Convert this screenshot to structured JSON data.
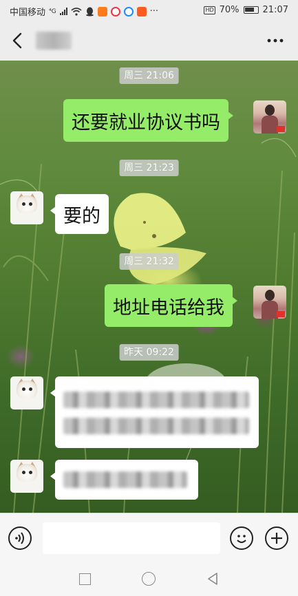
{
  "status_bar": {
    "carrier": "中国移动",
    "network": "⁴G",
    "battery_percent": "70%",
    "time": "21:07",
    "hd_label": "HD",
    "more": "···"
  },
  "header": {
    "back_icon": "chevron-left-icon",
    "more_icon": "ellipsis-icon"
  },
  "messages": [
    {
      "type": "timestamp",
      "text": "周三 21:06"
    },
    {
      "type": "text",
      "side": "out",
      "text": "还要就业协议书吗"
    },
    {
      "type": "timestamp",
      "text": "周三 21:23"
    },
    {
      "type": "text",
      "side": "in",
      "text": "要的"
    },
    {
      "type": "timestamp",
      "text": "周三 21:32"
    },
    {
      "type": "text",
      "side": "out",
      "text": "地址电话给我"
    },
    {
      "type": "timestamp",
      "text": "昨天 09:22"
    },
    {
      "type": "redacted",
      "side": "in"
    },
    {
      "type": "redacted",
      "side": "in"
    }
  ],
  "input_bar": {
    "voice_icon": "voice-icon",
    "emoji_icon": "emoji-icon",
    "plus_icon": "plus-icon"
  },
  "colors": {
    "bubble_out": "#95ec69",
    "bubble_in": "#ffffff",
    "chrome": "#ededed"
  }
}
